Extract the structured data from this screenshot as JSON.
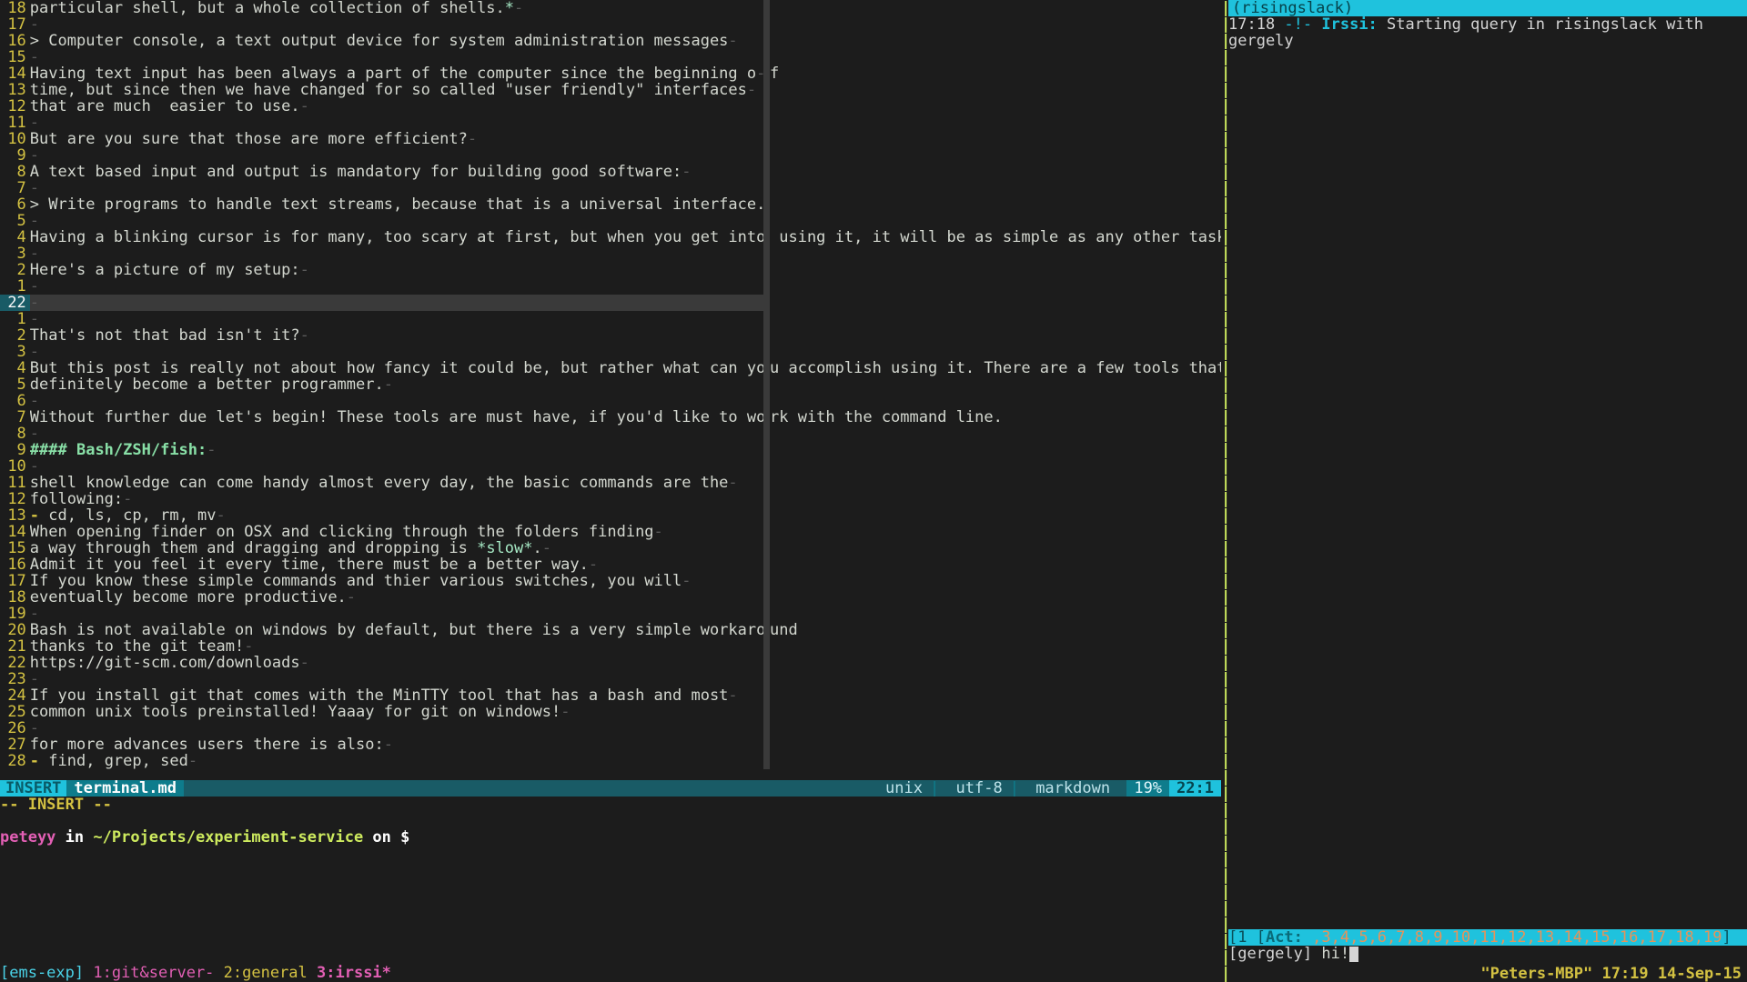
{
  "editor": {
    "lines": [
      {
        "num": "18",
        "gcur": false,
        "text": "particular shell, but a whole collection of shells.",
        "over": "",
        "md": "emtail",
        "trail": "*-"
      },
      {
        "num": "17",
        "gcur": false,
        "text": "",
        "over": "",
        "md": "blank",
        "trail": "-"
      },
      {
        "num": "16",
        "gcur": false,
        "text": "> Computer console, a text output device for system administration messages",
        "over": "",
        "md": "plain",
        "trail": "-"
      },
      {
        "num": "15",
        "gcur": false,
        "text": "",
        "over": "",
        "md": "blank",
        "trail": "-"
      },
      {
        "num": "14",
        "gcur": false,
        "text": "Having text input has been always a part of the computer since the beginning o",
        "over": "f",
        "md": "plain",
        "trail": "-"
      },
      {
        "num": "13",
        "gcur": false,
        "text": "time, but since then we have changed for so called \"user friendly\" interfaces",
        "over": "",
        "md": "plain",
        "trail": "-"
      },
      {
        "num": "12",
        "gcur": false,
        "text": "that are much  easier to use.",
        "over": "",
        "md": "plain",
        "trail": "-"
      },
      {
        "num": "11",
        "gcur": false,
        "text": "",
        "over": "",
        "md": "blank",
        "trail": "-"
      },
      {
        "num": "10",
        "gcur": false,
        "text": "But are you sure that those are more efficient?",
        "over": "",
        "md": "plain",
        "trail": "-"
      },
      {
        "num": "9",
        "gcur": false,
        "text": "",
        "over": "",
        "md": "blank",
        "trail": "-"
      },
      {
        "num": "8",
        "gcur": false,
        "text": "A text based input and output is mandatory for building good software:",
        "over": "",
        "md": "plain",
        "trail": "-"
      },
      {
        "num": "7",
        "gcur": false,
        "text": "",
        "over": "",
        "md": "blank",
        "trail": "-"
      },
      {
        "num": "6",
        "gcur": false,
        "text": "> Write programs to handle text streams, because that is a universal interface.",
        "over": "",
        "md": "plain",
        "trail": "-"
      },
      {
        "num": "5",
        "gcur": false,
        "text": "",
        "over": "",
        "md": "blank",
        "trail": "-"
      },
      {
        "num": "4",
        "gcur": false,
        "text": "Having a blinking cursor is for many, too scary at first, but when you get into",
        "over": " using it, it will be as simple as any other task.",
        "md": "plain",
        "trail": "-"
      },
      {
        "num": "3",
        "gcur": false,
        "text": "",
        "over": "",
        "md": "blank",
        "trail": "-"
      },
      {
        "num": "2",
        "gcur": false,
        "text": "Here's a picture of my setup:",
        "over": "",
        "md": "plain",
        "trail": "-"
      },
      {
        "num": "1",
        "gcur": false,
        "text": "",
        "over": "",
        "md": "blank",
        "trail": "-"
      },
      {
        "num": "22",
        "gcur": true,
        "text": "",
        "over": "",
        "md": "cursor",
        "trail": "-"
      },
      {
        "num": "1",
        "gcur": false,
        "text": "",
        "over": "",
        "md": "blank",
        "trail": "-"
      },
      {
        "num": "2",
        "gcur": false,
        "text": "That's not that bad isn't it?",
        "over": "",
        "md": "plain",
        "trail": "-"
      },
      {
        "num": "3",
        "gcur": false,
        "text": "",
        "over": "",
        "md": "blank",
        "trail": "-"
      },
      {
        "num": "4",
        "gcur": false,
        "text": "But this post is really not about how fancy it could be, but rather what can yo",
        "over": "u accomplish using it. There are a few tools that",
        "md": "plain",
        "trail": ""
      },
      {
        "num": "5",
        "gcur": false,
        "text": "definitely become a better programmer.",
        "over": "",
        "md": "plain",
        "trail": "-"
      },
      {
        "num": "6",
        "gcur": false,
        "text": "",
        "over": "",
        "md": "blank",
        "trail": "-"
      },
      {
        "num": "7",
        "gcur": false,
        "text": "Without further due let's begin! These tools are must have, if you'd like to wo",
        "over": "rk with the command line.",
        "md": "plain",
        "trail": "-"
      },
      {
        "num": "8",
        "gcur": false,
        "text": "",
        "over": "",
        "md": "blank",
        "trail": "-"
      },
      {
        "num": "9",
        "gcur": false,
        "text": "#### Bash/ZSH/fish:",
        "over": "",
        "md": "heading",
        "trail": "-"
      },
      {
        "num": "10",
        "gcur": false,
        "text": "",
        "over": "",
        "md": "blank",
        "trail": "-"
      },
      {
        "num": "11",
        "gcur": false,
        "text": "shell knowledge can come handy almost every day, the basic commands are the",
        "over": "",
        "md": "plain",
        "trail": "-"
      },
      {
        "num": "12",
        "gcur": false,
        "text": "following:",
        "over": "",
        "md": "plain",
        "trail": "-"
      },
      {
        "num": "13",
        "gcur": false,
        "text": "- cd, ls, cp, rm, mv",
        "over": "",
        "md": "list",
        "trail": "-"
      },
      {
        "num": "14",
        "gcur": false,
        "text": "When opening finder on OSX and clicking through the folders finding",
        "over": "",
        "md": "plain",
        "trail": "-"
      },
      {
        "num": "15",
        "gcur": false,
        "text": "a way through them and dragging and dropping is *slow*.",
        "over": "",
        "md": "emword",
        "trail": "-"
      },
      {
        "num": "16",
        "gcur": false,
        "text": "Admit it you feel it every time, there must be a better way.",
        "over": "",
        "md": "plain",
        "trail": "-"
      },
      {
        "num": "17",
        "gcur": false,
        "text": "If you know these simple commands and thier various switches, you will",
        "over": "",
        "md": "plain",
        "trail": "-"
      },
      {
        "num": "18",
        "gcur": false,
        "text": "eventually become more productive.",
        "over": "",
        "md": "plain",
        "trail": "-"
      },
      {
        "num": "19",
        "gcur": false,
        "text": "",
        "over": "",
        "md": "blank",
        "trail": "-"
      },
      {
        "num": "20",
        "gcur": false,
        "text": "Bash is not available on windows by default, but there is a very simple workaro",
        "over": "und",
        "md": "plain",
        "trail": "-"
      },
      {
        "num": "21",
        "gcur": false,
        "text": "thanks to the git team!",
        "over": "",
        "md": "plain",
        "trail": "-"
      },
      {
        "num": "22",
        "gcur": false,
        "text": "https://git-scm.com/downloads",
        "over": "",
        "md": "plain",
        "trail": "-"
      },
      {
        "num": "23",
        "gcur": false,
        "text": "",
        "over": "",
        "md": "blank",
        "trail": "-"
      },
      {
        "num": "24",
        "gcur": false,
        "text": "If you install git that comes with the MinTTY tool that has a bash and most",
        "over": "",
        "md": "plain",
        "trail": "-"
      },
      {
        "num": "25",
        "gcur": false,
        "text": "common unix tools preinstalled! Yaaay for git on windows!",
        "over": "",
        "md": "plain",
        "trail": "-"
      },
      {
        "num": "26",
        "gcur": false,
        "text": "",
        "over": "",
        "md": "blank",
        "trail": "-"
      },
      {
        "num": "27",
        "gcur": false,
        "text": "for more advances users there is also:",
        "over": "",
        "md": "plain",
        "trail": "-"
      },
      {
        "num": "28",
        "gcur": false,
        "text": "- find, grep, sed",
        "over": "",
        "md": "list",
        "trail": "-"
      }
    ]
  },
  "vimstatus": {
    "mode": " INSERT ",
    "file": " terminal.md ",
    "seg1": "unix",
    "seg2": "utf-8",
    "seg3": "markdown",
    "pct": " 19% ",
    "pos": "  22:1 "
  },
  "insert_msg": "-- INSERT --",
  "shell": {
    "user": "peteyy",
    "in": " in ",
    "path": "~/Projects/experiment-service",
    "on": " on ",
    "dollar": "$ "
  },
  "tmux": {
    "session": "[ems-exp]",
    "w1": " 1:git&server- ",
    "w2": " 2:general ",
    "w3": " 3:irssi*",
    "right": "\"Peters-MBP\" 17:19 14-Sep-15"
  },
  "irssi": {
    "header": "(risingslack)",
    "time": "17:18",
    "mark": " -!- ",
    "sys": "Irssi:",
    "msg1": " Starting query in risingslack with",
    "msg2": "            gergely",
    "act_pre": "[1 [",
    "act_label": "Act: ",
    "act_nums": " ,3,4,5,6,7,8,9,10,11,12,13,14,15,16,17,18,19",
    "act_post": "]",
    "input_nick": "[gergely] ",
    "input_text": "hi!"
  }
}
